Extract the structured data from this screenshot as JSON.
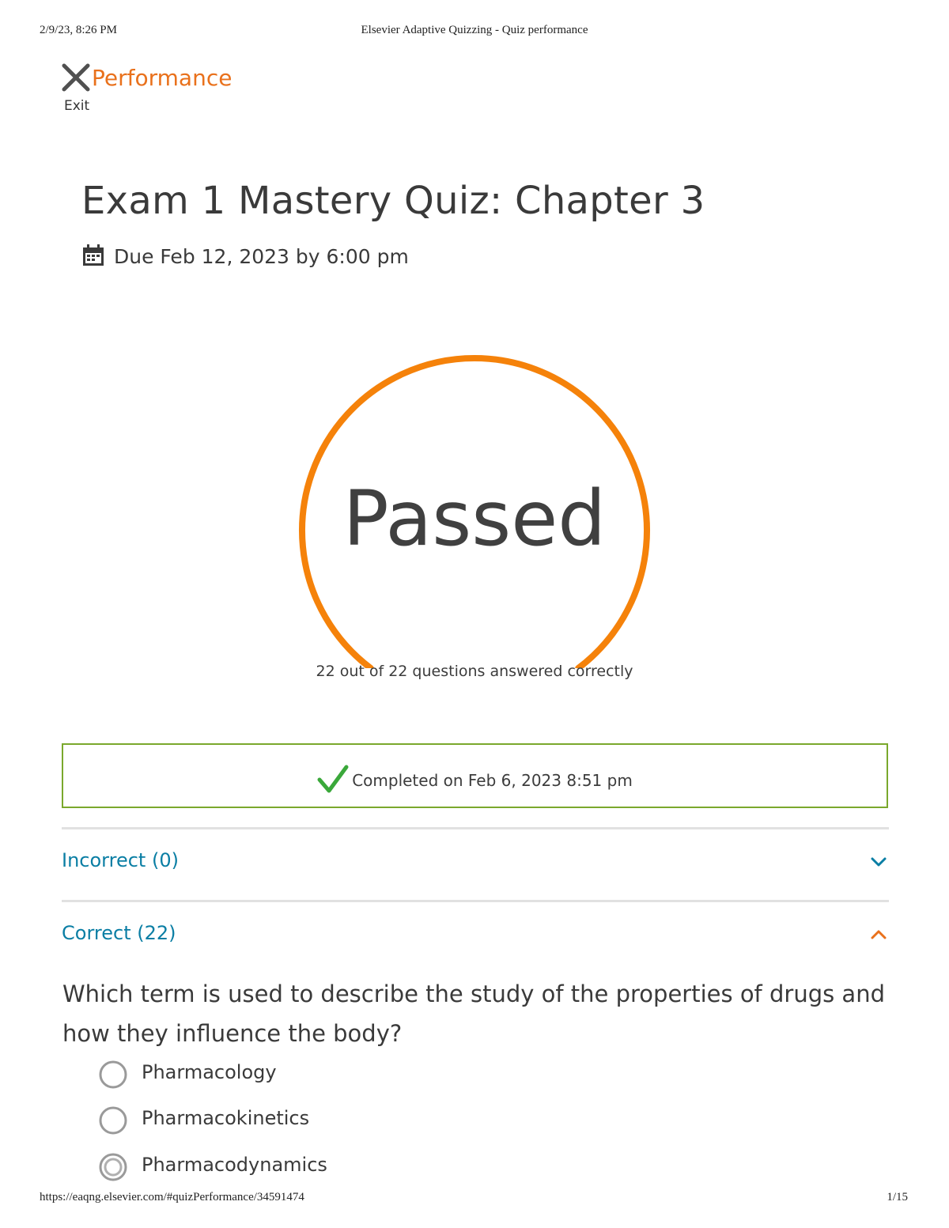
{
  "print_header": {
    "datetime": "2/9/23, 8:26 PM",
    "page_title": "Elsevier Adaptive Quizzing - Quiz performance"
  },
  "print_footer": {
    "url": "https://eaqng.elsevier.com/#quizPerformance/34591474",
    "page_counter": "1/15"
  },
  "header": {
    "exit_label": "Exit",
    "section_label": "Performance",
    "close_icon": "close-x-icon"
  },
  "quiz": {
    "title": "Exam 1 Mastery Quiz: Chapter 3",
    "due_text": "Due Feb 12, 2023 by 6:00 pm",
    "due_icon": "calendar-icon"
  },
  "result": {
    "status": "Passed",
    "caption": "22 out of 22 questions answered correctly",
    "correct": 22,
    "total": 22,
    "gauge_color": "#f5820a"
  },
  "completion": {
    "text": "Completed on Feb 6, 2023 8:51 pm",
    "icon": "checkmark-icon",
    "border_color": "#7aa82c",
    "check_color": "#3aa83a"
  },
  "sections": {
    "incorrect": {
      "label": "Incorrect (0)",
      "expanded": false,
      "chevron": "chevron-down-icon"
    },
    "correct": {
      "label": "Correct (22)",
      "expanded": true,
      "chevron": "chevron-up-icon"
    }
  },
  "question": {
    "text": "Which term is used to describe the study of the properties of drugs and how they influence the body?",
    "options": [
      {
        "label": "Pharmacology",
        "selected": false
      },
      {
        "label": "Pharmacokinetics",
        "selected": false
      },
      {
        "label": "Pharmacodynamics",
        "selected": true
      }
    ]
  },
  "colors": {
    "accent_orange": "#e9711c",
    "link_blue": "#0a7ea4",
    "text_dark": "#3a3a3a"
  }
}
